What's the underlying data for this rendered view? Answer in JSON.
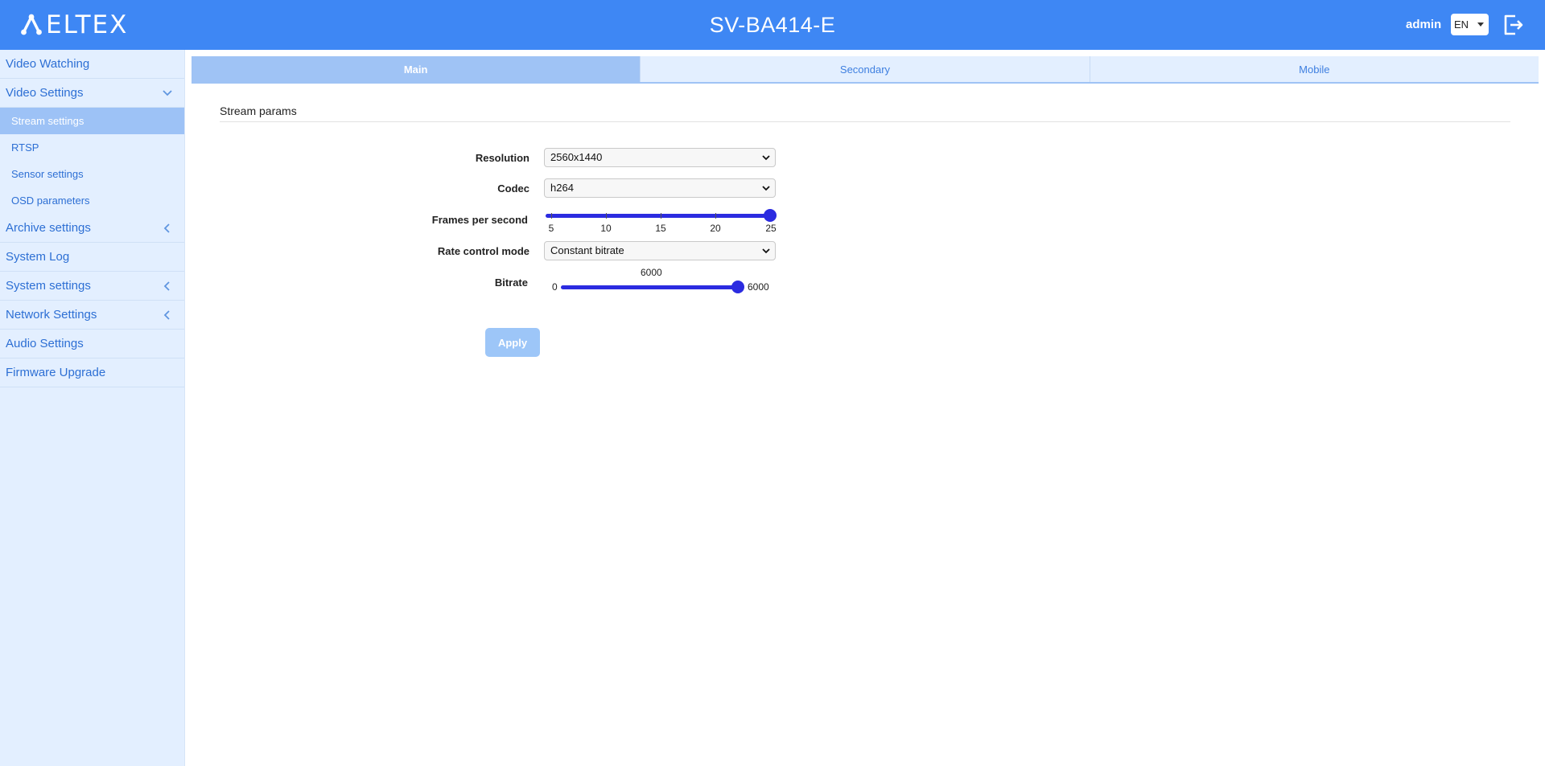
{
  "header": {
    "logo_text": "ELTEX",
    "device_title": "SV-BA414-E",
    "user": "admin",
    "language": "EN",
    "logout_icon": "logout-icon"
  },
  "sidebar": {
    "items": [
      {
        "label": "Video Watching"
      },
      {
        "label": "Video Settings",
        "icon": "chevron-down-icon"
      },
      {
        "label": "Stream settings"
      },
      {
        "label": "RTSP"
      },
      {
        "label": "Sensor settings"
      },
      {
        "label": "OSD parameters"
      },
      {
        "label": "Archive settings",
        "icon": "chevron-left-icon"
      },
      {
        "label": "System Log"
      },
      {
        "label": "System settings",
        "icon": "chevron-left-icon"
      },
      {
        "label": "Network Settings",
        "icon": "chevron-left-icon"
      },
      {
        "label": "Audio Settings"
      },
      {
        "label": "Firmware Upgrade"
      }
    ]
  },
  "tabs": [
    {
      "label": "Main",
      "active": true
    },
    {
      "label": "Secondary"
    },
    {
      "label": "Mobile"
    }
  ],
  "section": {
    "title": "Stream params"
  },
  "form": {
    "resolution": {
      "label": "Resolution",
      "value": "2560x1440"
    },
    "codec": {
      "label": "Codec",
      "value": "h264"
    },
    "fps": {
      "label": "Frames per second",
      "ticks": [
        "5",
        "10",
        "15",
        "20",
        "25"
      ],
      "value": 25,
      "min": 5,
      "max": 25
    },
    "rate_control": {
      "label": "Rate control mode",
      "value": "Constant bitrate"
    },
    "bitrate": {
      "label": "Bitrate",
      "min_label": "0",
      "max_label": "6000",
      "value_label": "6000",
      "value": 6000,
      "min": 0,
      "max": 6000
    }
  },
  "apply_label": "Apply",
  "colors": {
    "header": "#3e87f4",
    "sidebar": "#e3efff",
    "accent": "#2b2be0",
    "active_item": "#9dc2f6"
  }
}
